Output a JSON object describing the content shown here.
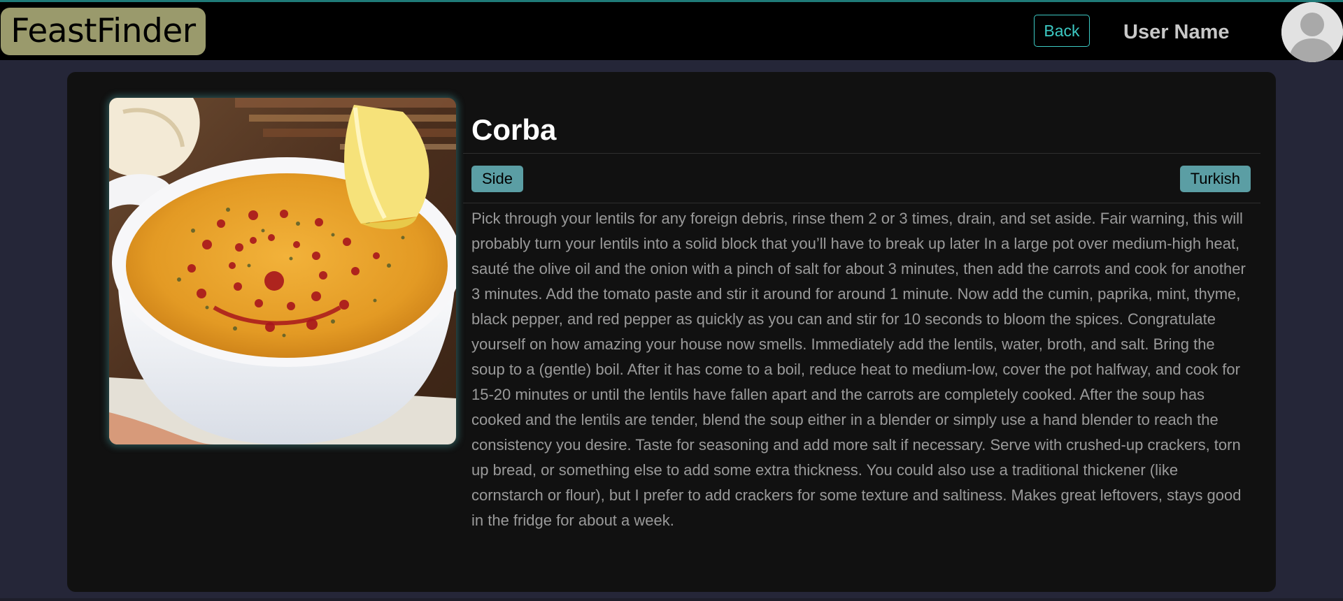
{
  "navbar": {
    "brand": "FeastFinder",
    "back_label": "Back",
    "user_name": "User Name",
    "avatar_icon": "user-avatar-icon"
  },
  "meal": {
    "title": "Corba",
    "category": "Side",
    "area": "Turkish",
    "instructions": "Pick through your lentils for any foreign debris, rinse them 2 or 3 times, drain, and set aside. Fair warning, this will probably turn your lentils into a solid block that you’ll have to break up later In a large pot over medium-high heat, sauté the olive oil and the onion with a pinch of salt for about 3 minutes, then add the carrots and cook for another 3 minutes. Add the tomato paste and stir it around for around 1 minute. Now add the cumin, paprika, mint, thyme, black pepper, and red pepper as quickly as you can and stir for 10 seconds to bloom the spices. Congratulate yourself on how amazing your house now smells. Immediately add the lentils, water, broth, and salt. Bring the soup to a (gentle) boil. After it has come to a boil, reduce heat to medium-low, cover the pot halfway, and cook for 15-20 minutes or until the lentils have fallen apart and the carrots are completely cooked. After the soup has cooked and the lentils are tender, blend the soup either in a blender or simply use a hand blender to reach the consistency you desire. Taste for seasoning and add more salt if necessary. Serve with crushed-up crackers, torn up bread, or something else to add some extra thickness. You could also use a traditional thickener (like cornstarch or flour), but I prefer to add crackers for some texture and saltiness. Makes great leftovers, stays good in the fridge for about a week."
  },
  "colors": {
    "page_bg": "#252638",
    "navbar_bg": "#000000",
    "brand_bg": "#9a9a6c",
    "accent": "#3cc9c3",
    "card_bg": "#111111",
    "tag_bg": "#5b9ea4"
  }
}
